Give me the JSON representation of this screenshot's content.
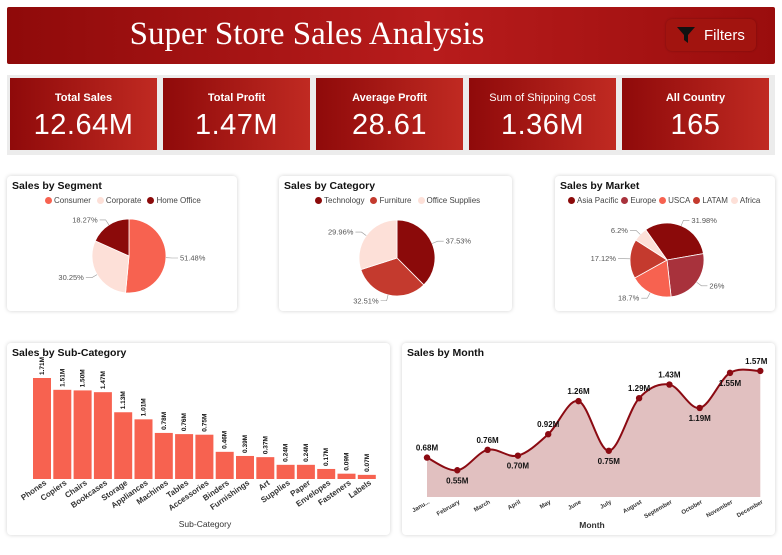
{
  "header": {
    "title": "Super Store Sales Analysis",
    "filters_label": "Filters"
  },
  "kpis": [
    {
      "label": "Total Sales",
      "value": "12.64M"
    },
    {
      "label": "Total Profit",
      "value": "1.47M"
    },
    {
      "label": "Average Profit",
      "value": "28.61"
    },
    {
      "label": "Sum of Shipping Cost",
      "value": "1.36M"
    },
    {
      "label": "All Country",
      "value": "165"
    }
  ],
  "colors": {
    "brand_dark": "#8f0a0a",
    "brand_light": "#c02a22",
    "bar": "#f76250",
    "line": "#8b0a12",
    "area": "#dcb5b5"
  },
  "chart_data": [
    {
      "id": "segment",
      "type": "pie",
      "title": "Sales by Segment",
      "categories": [
        "Consumer",
        "Corporate",
        "Home Office"
      ],
      "values": [
        51.48,
        30.25,
        18.27
      ],
      "labels": [
        "51.48%",
        "30.25%",
        "18.27%"
      ],
      "colors": [
        "#f76250",
        "#fde0d8",
        "#8b0a0a"
      ],
      "legend": "top"
    },
    {
      "id": "category",
      "type": "pie",
      "title": "Sales by Category",
      "categories": [
        "Technology",
        "Furniture",
        "Office Supplies"
      ],
      "values": [
        37.53,
        32.51,
        29.96
      ],
      "labels": [
        "37.53%",
        "32.51%",
        "29.96%"
      ],
      "colors": [
        "#8b0a0a",
        "#c43a2e",
        "#fde0d8"
      ],
      "legend": "top"
    },
    {
      "id": "market",
      "type": "pie",
      "title": "Sales by Market",
      "categories": [
        "Asia Pacific",
        "Europe",
        "USCA",
        "LATAM",
        "Africa"
      ],
      "values": [
        31.98,
        26,
        18.7,
        17.12,
        6.2
      ],
      "labels": [
        "31.98%",
        "26%",
        "18.7%",
        "17.12%",
        "6.2%"
      ],
      "colors": [
        "#8b0a0a",
        "#a8323c",
        "#f76250",
        "#c43a2e",
        "#fde0d8"
      ],
      "legend": "top"
    },
    {
      "id": "subcategory",
      "type": "bar",
      "title": "Sales by Sub-Category",
      "xlabel": "Sub-Category",
      "ylabel": "",
      "categories": [
        "Phones",
        "Copiers",
        "Chairs",
        "Bookcases",
        "Storage",
        "Appliances",
        "Machines",
        "Tables",
        "Accessories",
        "Binders",
        "Furnishings",
        "Art",
        "Supplies",
        "Paper",
        "Envelopes",
        "Fasteners",
        "Labels"
      ],
      "values": [
        1.71,
        1.51,
        1.5,
        1.47,
        1.13,
        1.01,
        0.78,
        0.76,
        0.75,
        0.46,
        0.39,
        0.37,
        0.24,
        0.24,
        0.17,
        0.09,
        0.07
      ],
      "labels": [
        "1.71M",
        "1.51M",
        "1.50M",
        "1.47M",
        "1.13M",
        "1.01M",
        "0.78M",
        "0.76M",
        "0.75M",
        "0.46M",
        "0.39M",
        "0.37M",
        "0.24M",
        "0.24M",
        "0.17M",
        "0.09M",
        "0.07M"
      ],
      "ylim": [
        0,
        1.71
      ]
    },
    {
      "id": "month",
      "type": "area",
      "title": "Sales by Month",
      "xlabel": "Month",
      "ylabel": "",
      "categories": [
        "Janu...",
        "February",
        "March",
        "April",
        "May",
        "June",
        "July",
        "August",
        "September",
        "October",
        "November",
        "December"
      ],
      "values": [
        0.68,
        0.55,
        0.76,
        0.7,
        0.92,
        1.26,
        0.75,
        1.29,
        1.43,
        1.19,
        1.55,
        1.57
      ],
      "labels": [
        "0.68M",
        "0.55M",
        "0.76M",
        "0.70M",
        "0.92M",
        "1.26M",
        "0.75M",
        "1.29M",
        "1.43M",
        "1.19M",
        "1.55M",
        "1.57M"
      ],
      "ylim": [
        0.45,
        1.6
      ]
    }
  ]
}
